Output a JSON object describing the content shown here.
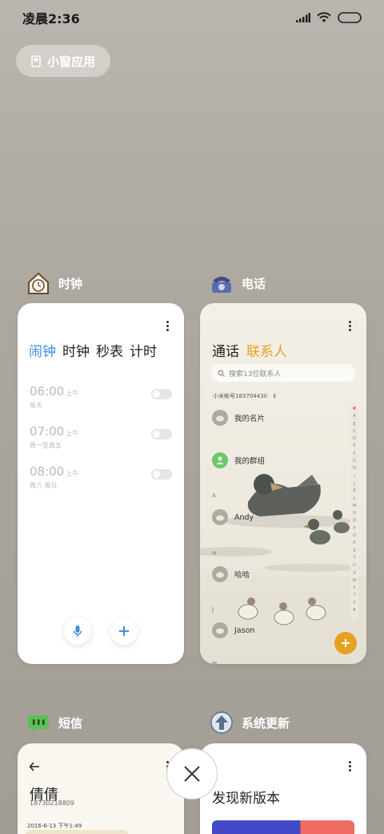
{
  "status": {
    "time": "凌晨2:36"
  },
  "small_window": {
    "label": "小窗应用"
  },
  "apps": {
    "clock": {
      "name": "时钟",
      "tabs": [
        "闹钟",
        "时钟",
        "秒表",
        "计时"
      ],
      "alarms": [
        {
          "time": "06:00",
          "ampm": "上午",
          "repeat": "每天"
        },
        {
          "time": "07:00",
          "ampm": "上午",
          "repeat": "周一至周五"
        },
        {
          "time": "08:00",
          "ampm": "上午",
          "repeat": "周六 周日"
        }
      ]
    },
    "phone": {
      "name": "电话",
      "tabs": [
        "通话",
        "联系人"
      ],
      "search_placeholder": "搜索13位联系人",
      "account": "小米帐号183704430",
      "rows": {
        "my_card": "我的名片",
        "my_groups": "我的群组",
        "letter_a": "A",
        "andy": "Andy",
        "letter_h": "H",
        "haha": "哈哈",
        "letter_j": "J",
        "jason": "Jason",
        "letter_m": "M"
      },
      "alphabet": [
        "♥",
        "A",
        "B",
        "C",
        "D",
        "E",
        "F",
        "G",
        "H",
        "I",
        "J",
        "K",
        "L",
        "M",
        "N",
        "O",
        "P",
        "Q",
        "R",
        "S",
        "T",
        "U",
        "V",
        "W",
        "X",
        "Y",
        "Z",
        "#"
      ]
    },
    "sms": {
      "name": "短信",
      "contact_name": "倩倩",
      "contact_number": "18730218809",
      "date": "2016-6-13 下午1:49"
    },
    "update": {
      "name": "系统更新",
      "title": "发现新版本"
    }
  },
  "colors": {
    "clock_accent": "#3b8ee6",
    "phone_accent": "#e6a21f"
  }
}
